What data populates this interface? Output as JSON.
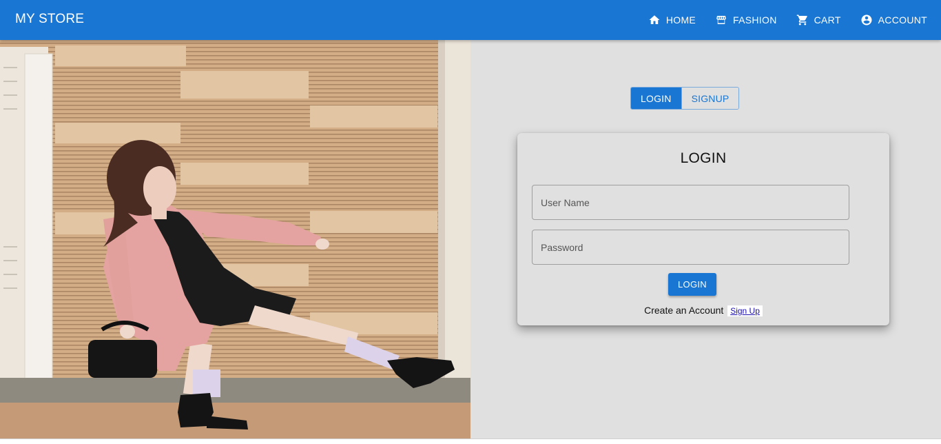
{
  "app": {
    "brand": "MY STORE"
  },
  "nav": {
    "home": "HOME",
    "fashion": "FASHION",
    "cart": "CART",
    "account": "ACCOUNT"
  },
  "toggle": {
    "login": "LOGIN",
    "signup": "SIGNUP",
    "selected": "LOGIN"
  },
  "login_card": {
    "title": "LOGIN",
    "username_placeholder": "User Name",
    "username_value": "",
    "password_placeholder": "Password",
    "password_value": "",
    "submit_label": "LOGIN",
    "create_account_text": "Create an Account",
    "signup_link": "Sign Up"
  },
  "colors": {
    "primary": "#1976d2",
    "panel_bg": "#e0e0e0",
    "coat_pink": "#e4a3a0",
    "brick_tan": "#d8b48c"
  },
  "icons": {
    "home": "home-icon",
    "fashion": "storefront-icon",
    "cart": "cart-icon",
    "account": "account-circle-icon"
  }
}
